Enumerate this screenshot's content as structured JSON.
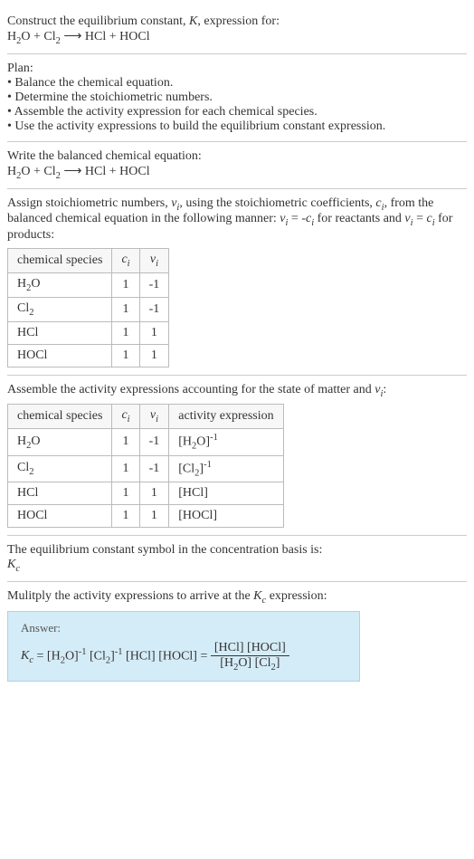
{
  "prompt": {
    "line1": "Construct the equilibrium constant, K, expression for:",
    "equation": "H₂O + Cl₂ ⟶ HCl + HOCl"
  },
  "plan": {
    "heading": "Plan:",
    "items": [
      "Balance the chemical equation.",
      "Determine the stoichiometric numbers.",
      "Assemble the activity expression for each chemical species.",
      "Use the activity expressions to build the equilibrium constant expression."
    ]
  },
  "balanced": {
    "heading": "Write the balanced chemical equation:",
    "equation": "H₂O + Cl₂ ⟶ HCl + HOCl"
  },
  "stoich": {
    "heading": "Assign stoichiometric numbers, νᵢ, using the stoichiometric coefficients, cᵢ, from the balanced chemical equation in the following manner: νᵢ = -cᵢ for reactants and νᵢ = cᵢ for products:",
    "headers": {
      "species": "chemical species",
      "ci": "cᵢ",
      "vi": "νᵢ"
    },
    "rows": [
      {
        "species": "H₂O",
        "ci": "1",
        "vi": "-1"
      },
      {
        "species": "Cl₂",
        "ci": "1",
        "vi": "-1"
      },
      {
        "species": "HCl",
        "ci": "1",
        "vi": "1"
      },
      {
        "species": "HOCl",
        "ci": "1",
        "vi": "1"
      }
    ]
  },
  "activity": {
    "heading": "Assemble the activity expressions accounting for the state of matter and νᵢ:",
    "headers": {
      "species": "chemical species",
      "ci": "cᵢ",
      "vi": "νᵢ",
      "expr": "activity expression"
    },
    "rows": [
      {
        "species": "H₂O",
        "ci": "1",
        "vi": "-1",
        "expr": "[H₂O]⁻¹"
      },
      {
        "species": "Cl₂",
        "ci": "1",
        "vi": "-1",
        "expr": "[Cl₂]⁻¹"
      },
      {
        "species": "HCl",
        "ci": "1",
        "vi": "1",
        "expr": "[HCl]"
      },
      {
        "species": "HOCl",
        "ci": "1",
        "vi": "1",
        "expr": "[HOCl]"
      }
    ]
  },
  "symbol": {
    "heading": "The equilibrium constant symbol in the concentration basis is:",
    "value": "K_c"
  },
  "multiply": {
    "heading": "Mulitply the activity expressions to arrive at the K_c expression:"
  },
  "answer": {
    "label": "Answer:",
    "lhs": "K_c = [H₂O]⁻¹ [Cl₂]⁻¹ [HCl] [HOCl] =",
    "num": "[HCl] [HOCl]",
    "den": "[H₂O] [Cl₂]"
  },
  "chart_data": {
    "type": "table",
    "tables": [
      {
        "title": "Stoichiometric numbers",
        "columns": [
          "chemical species",
          "c_i",
          "ν_i"
        ],
        "rows": [
          [
            "H2O",
            1,
            -1
          ],
          [
            "Cl2",
            1,
            -1
          ],
          [
            "HCl",
            1,
            1
          ],
          [
            "HOCl",
            1,
            1
          ]
        ]
      },
      {
        "title": "Activity expressions",
        "columns": [
          "chemical species",
          "c_i",
          "ν_i",
          "activity expression"
        ],
        "rows": [
          [
            "H2O",
            1,
            -1,
            "[H2O]^-1"
          ],
          [
            "Cl2",
            1,
            -1,
            "[Cl2]^-1"
          ],
          [
            "HCl",
            1,
            1,
            "[HCl]"
          ],
          [
            "HOCl",
            1,
            1,
            "[HOCl]"
          ]
        ]
      }
    ],
    "equilibrium_constant_expression": "K_c = ([HCl][HOCl]) / ([H2O][Cl2])"
  }
}
